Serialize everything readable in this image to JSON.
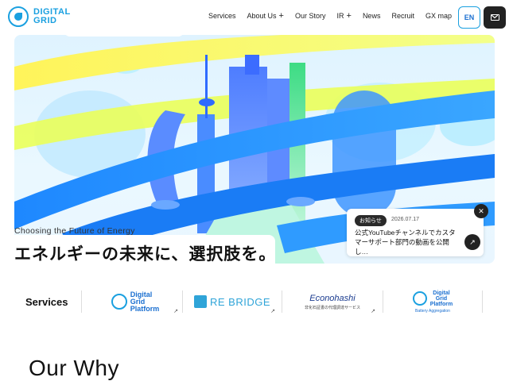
{
  "header": {
    "logo_line1": "DIGITAL",
    "logo_line2": "GRID",
    "nav": [
      {
        "label": "Services",
        "has_plus": false
      },
      {
        "label": "About Us",
        "has_plus": true
      },
      {
        "label": "Our Story",
        "has_plus": false
      },
      {
        "label": "IR",
        "has_plus": true
      },
      {
        "label": "News",
        "has_plus": false
      },
      {
        "label": "Recruit",
        "has_plus": false
      },
      {
        "label": "GX map",
        "has_plus": false
      }
    ],
    "lang_button": "EN"
  },
  "hero": {
    "tagline": "Choosing the Future of Energy",
    "headline": "エネルギーの未来に、選択肢を。"
  },
  "news": {
    "badge": "お知らせ",
    "date": "2026.07.17",
    "text": "公式YouTubeチャンネルでカスタマーサポート部門の動画を公開し…"
  },
  "services": {
    "label": "Services",
    "items": [
      {
        "name_line1": "Digital",
        "name_line2": "Grid",
        "name_line3": "Platform",
        "sub": ""
      },
      {
        "name_line1": "RE BRIDGE",
        "name_line2": "",
        "name_line3": "",
        "sub": ""
      },
      {
        "name_line1": "Econohashi",
        "name_line2": "",
        "name_line3": "",
        "sub": "非化石証書の代理調達サービス"
      },
      {
        "name_line1": "Digital",
        "name_line2": "Grid",
        "name_line3": "Platform",
        "sub": "Battery Aggregation"
      }
    ]
  },
  "section_title": "Our Why",
  "colors": {
    "brand": "#1aa0e0",
    "accent_blue": "#1a6fd0",
    "dark": "#222222"
  }
}
